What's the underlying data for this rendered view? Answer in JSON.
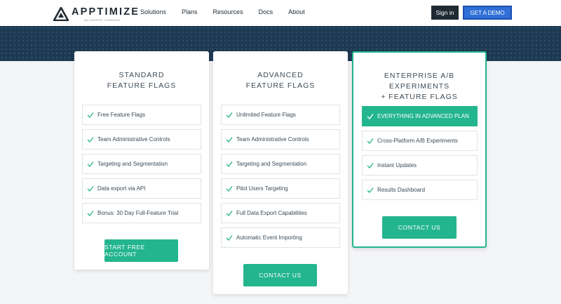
{
  "brand": {
    "name": "APPTIMIZE",
    "tagline": "AN AIRSHIP COMPANY"
  },
  "nav": {
    "items": [
      "Solutions",
      "Plans",
      "Resources",
      "Docs",
      "About"
    ]
  },
  "header": {
    "signin_label": "Sign in",
    "demo_label": "GET A DEMO"
  },
  "colors": {
    "accent": "#23b58e",
    "dark": "#1f2a33",
    "demo_blue": "#2f6fd6",
    "banner": "#1e3a52"
  },
  "plans": [
    {
      "title_lines": [
        "STANDARD",
        "FEATURE FLAGS"
      ],
      "features": [
        "Free Feature Flags",
        "Team Administrative Controls",
        "Targeting and Segmentation",
        "Data export via API",
        "Bonus: 30 Day Full-Feature Trial"
      ],
      "cta": "START FREE ACCOUNT"
    },
    {
      "title_lines": [
        "ADVANCED",
        "FEATURE FLAGS"
      ],
      "features": [
        "Unlimited Feature Flags",
        "Team Administrative Controls",
        "Targeting and Segmentation",
        "Pilot Users Targeting",
        "Full Data Export Capabilities",
        "Automatic Event Importing"
      ],
      "cta": "CONTACT US"
    },
    {
      "title_lines": [
        "ENTERPRISE A/B EXPERIMENTS",
        "+ FEATURE FLAGS"
      ],
      "features": [
        "EVERYTHING IN ADVANCED PLAN",
        "Cross-Platform A/B Experiments",
        "Instant Updates",
        "Results Dashboard"
      ],
      "cta": "CONTACT US"
    }
  ]
}
